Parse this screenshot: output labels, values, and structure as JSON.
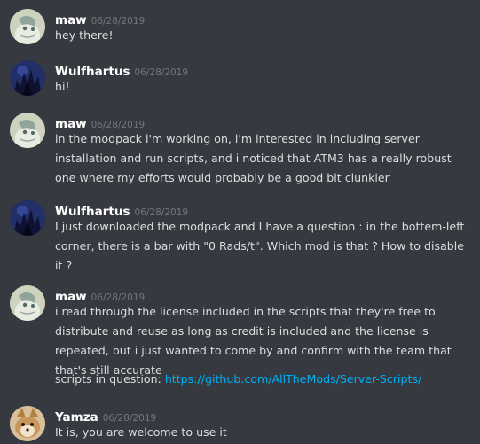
{
  "messages": [
    {
      "author": "maw",
      "timestamp": "06/28/2019",
      "avatar_icon": "maw-avatar",
      "text": "hey there!"
    },
    {
      "author": "Wulfhartus",
      "timestamp": "06/28/2019",
      "avatar_icon": "wulfhartus-avatar",
      "text": "hi!"
    },
    {
      "author": "maw",
      "timestamp": "06/28/2019",
      "avatar_icon": "maw-avatar",
      "text": "in the modpack i'm working on, i'm interested in including server installation and run scripts, and i noticed that ATM3 has a really robust one where my efforts would probably be a good bit clunkier"
    },
    {
      "author": "Wulfhartus",
      "timestamp": "06/28/2019",
      "avatar_icon": "wulfhartus-avatar",
      "text": "I just downloaded the modpack and I have a question : in the bottem-left corner, there is a bar with \"0 Rads/t\". Which mod is that ? How to disable it ?"
    },
    {
      "author": "maw",
      "timestamp": "06/28/2019",
      "avatar_icon": "maw-avatar",
      "text": "i read through the license included in the scripts that they're free to distribute and reuse as long as credit is included and the license is repeated, but i just wanted to come by and confirm with the team that that's still accurate",
      "followup_prefix": "scripts in question: ",
      "followup_link": "https://github.com/AllTheMods/Server-Scripts/"
    },
    {
      "author": "Yamza",
      "timestamp": "06/28/2019",
      "avatar_icon": "yamza-avatar",
      "text": "It is, you are welcome to use it"
    }
  ],
  "colors": {
    "background": "#36393f",
    "username": "#ffffff",
    "timestamp": "#72767d",
    "message_text": "#dcddde",
    "link": "#00b0f4"
  }
}
